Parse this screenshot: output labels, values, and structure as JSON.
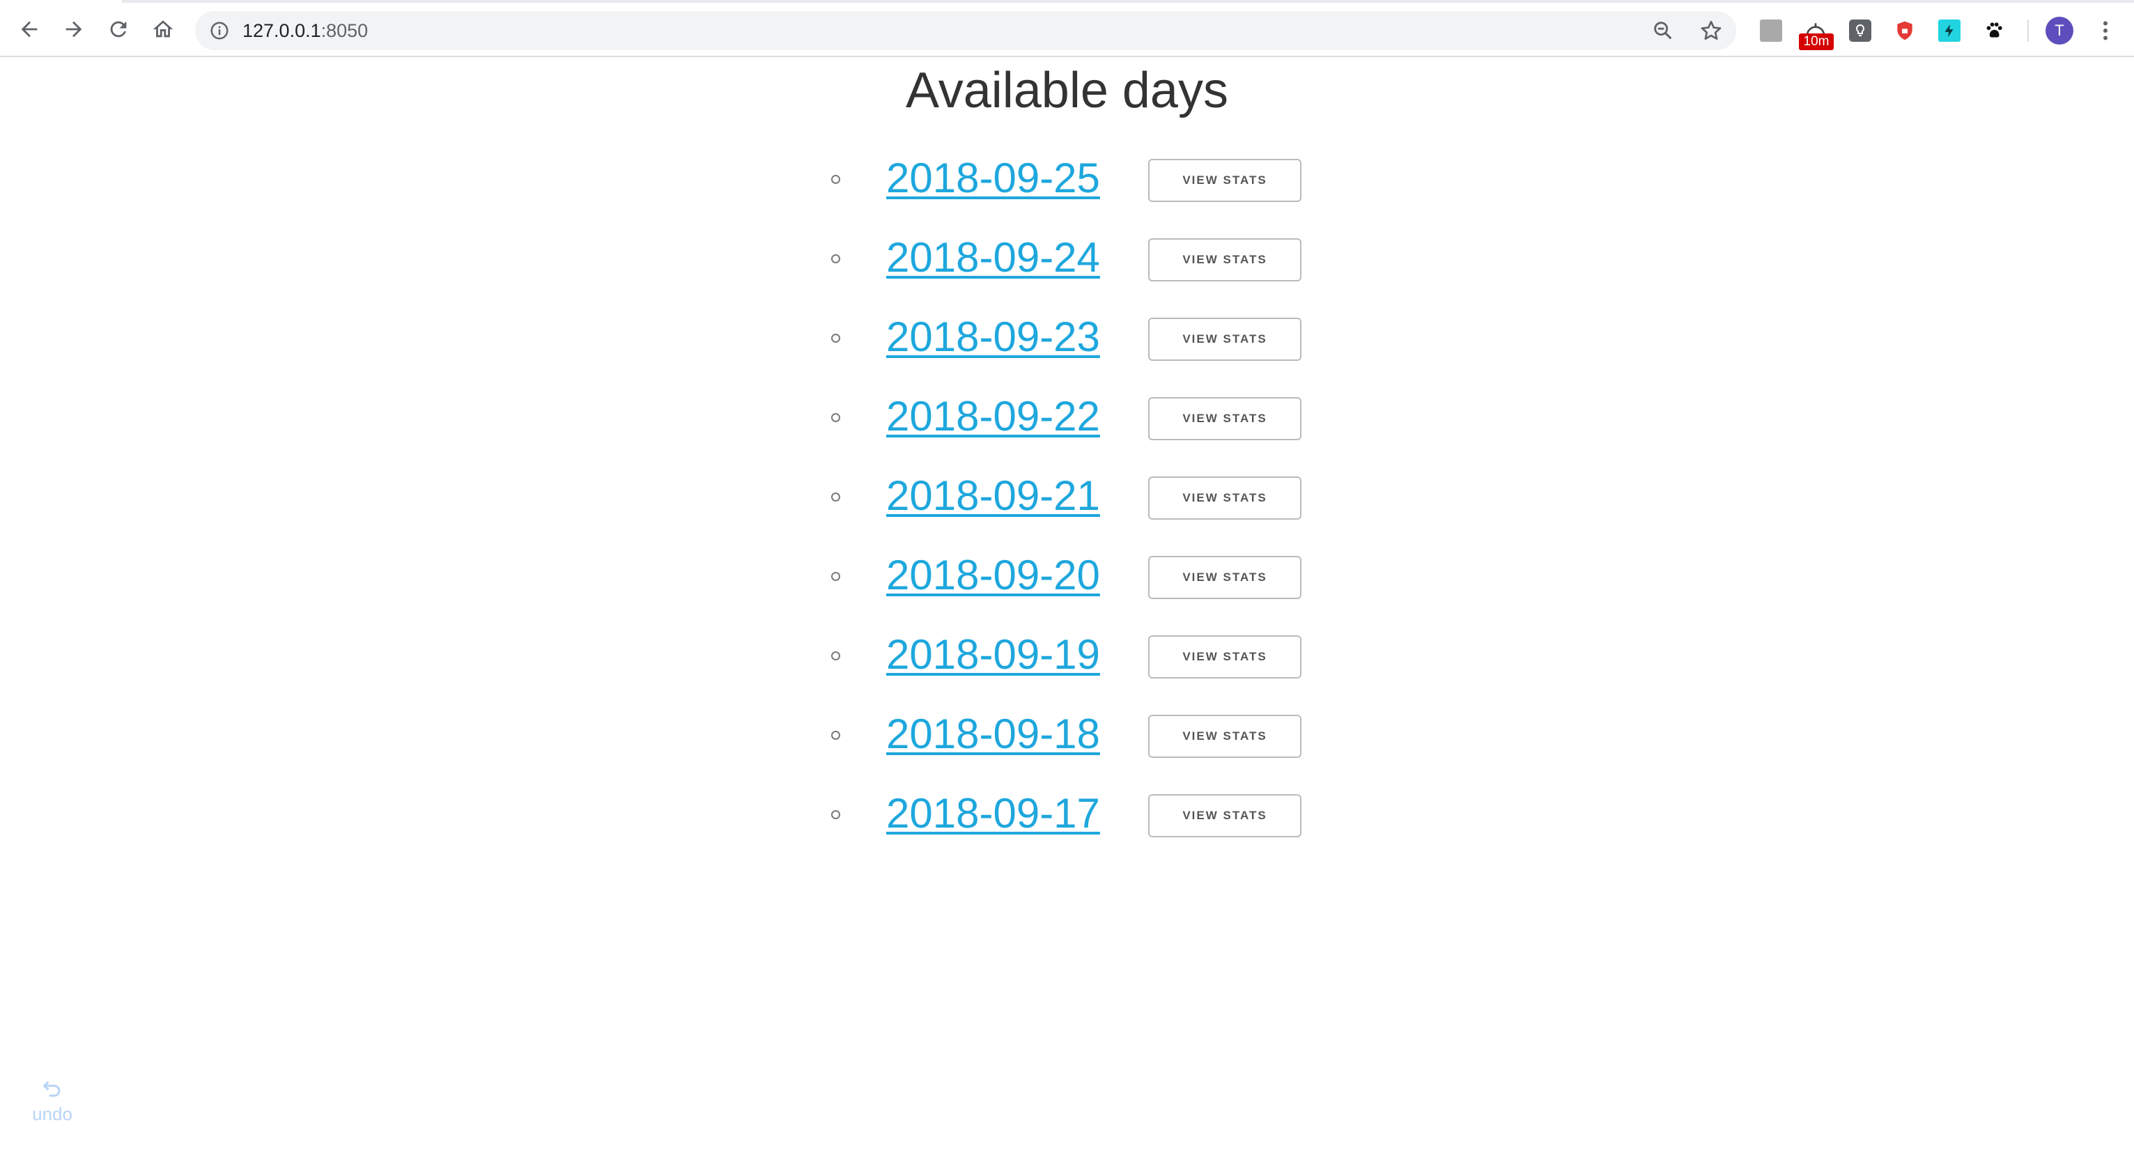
{
  "browser": {
    "url_host": "127.0.0.1",
    "url_port": ":8050",
    "timer_badge": "10m",
    "avatar_initial": "T",
    "icons": {
      "back": "arrow-left-icon",
      "forward": "arrow-right-icon",
      "reload": "reload-icon",
      "home": "home-icon",
      "site_info": "info-icon",
      "zoom": "zoom-out-icon",
      "bookmark": "star-icon",
      "menu": "kebab-menu-icon"
    }
  },
  "page": {
    "title": "Available days",
    "button_label": "VIEW STATS",
    "link_color": "#1ea7dd",
    "days": [
      {
        "date": "2018-09-25",
        "button": "VIEW STATS"
      },
      {
        "date": "2018-09-24",
        "button": "VIEW STATS"
      },
      {
        "date": "2018-09-23",
        "button": "VIEW STATS"
      },
      {
        "date": "2018-09-22",
        "button": "VIEW STATS"
      },
      {
        "date": "2018-09-21",
        "button": "VIEW STATS"
      },
      {
        "date": "2018-09-20",
        "button": "VIEW STATS"
      },
      {
        "date": "2018-09-19",
        "button": "VIEW STATS"
      },
      {
        "date": "2018-09-18",
        "button": "VIEW STATS"
      },
      {
        "date": "2018-09-17",
        "button": "VIEW STATS"
      }
    ]
  },
  "undo": {
    "label": "undo",
    "icon": "undo-icon"
  }
}
